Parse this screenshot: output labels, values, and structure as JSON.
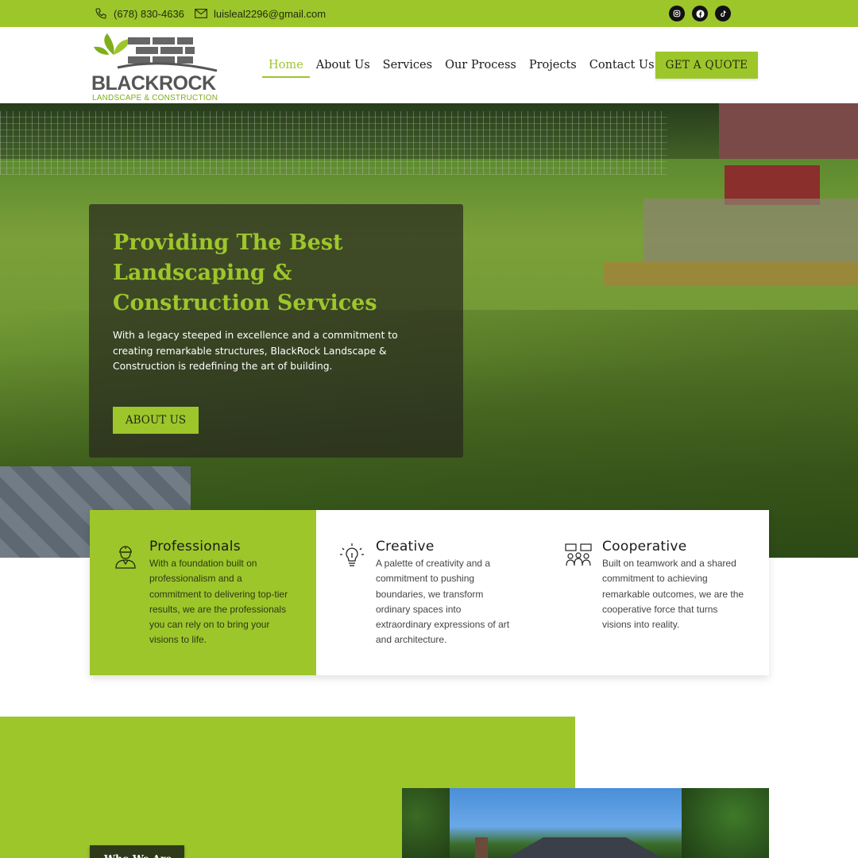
{
  "topbar": {
    "phone": "(678) 830-4636",
    "email": "luisleal2296@gmail.com",
    "socials": [
      "instagram-icon",
      "facebook-icon",
      "tiktok-icon"
    ]
  },
  "logo": {
    "wordmark": "BLACKROCK",
    "tagline": "LANDSCAPE & CONSTRUCTION"
  },
  "nav": {
    "items": [
      {
        "label": "Home",
        "active": true
      },
      {
        "label": "About Us"
      },
      {
        "label": "Services"
      },
      {
        "label": "Our Process"
      },
      {
        "label": "Projects"
      },
      {
        "label": "Contact Us"
      }
    ],
    "cta": "GET A QUOTE"
  },
  "hero": {
    "title": "Providing The Best Landscaping & Construction Services",
    "body": "With a legacy steeped in excellence and a commitment to creating remarkable structures, BlackRock Landscape & Construction is redefining the art of building.",
    "button": "ABOUT US"
  },
  "features": [
    {
      "icon": "worker-icon",
      "title": "Professionals",
      "text": "With a foundation built on professionalism and a commitment to delivering top-tier results, we are the professionals you can rely on to bring your visions to life."
    },
    {
      "icon": "lightbulb-icon",
      "title": "Creative",
      "text": "A palette of creativity and a commitment to pushing boundaries, we transform ordinary spaces into extraordinary expressions of art and architecture."
    },
    {
      "icon": "team-icon",
      "title": "Cooperative",
      "text": "Built on teamwork and a shared commitment to achieving remarkable outcomes, we are the cooperative force that turns visions into reality."
    }
  ],
  "who": {
    "label": "Who We Are"
  },
  "colors": {
    "accent": "#9dc62b",
    "dark": "#1a1a1a"
  }
}
